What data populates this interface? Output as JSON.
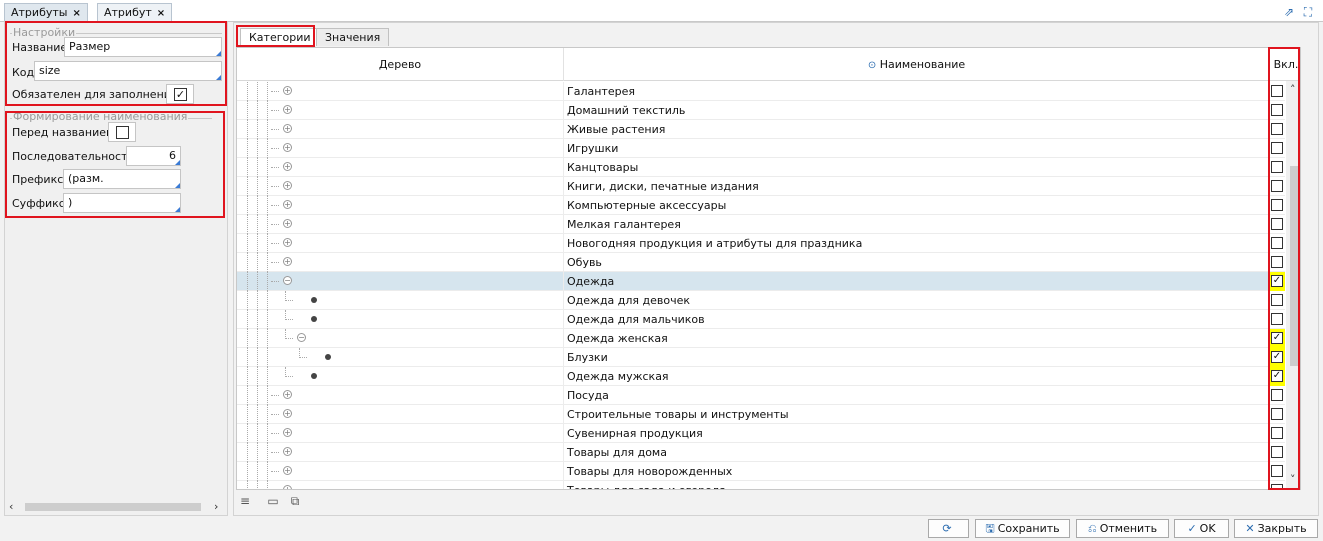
{
  "tabs": [
    {
      "label": "Атрибуты",
      "close": "×"
    },
    {
      "label": "Атрибут",
      "close": "×"
    }
  ],
  "settings": {
    "group_title": "Настройки",
    "name_label": "Название",
    "name_value": "Размер",
    "code_label": "Код",
    "code_value": "size",
    "required_label": "Обязателен для заполнения",
    "required_checked": true
  },
  "naming": {
    "group_title": "Формирование наименования",
    "before_label": "Перед названием",
    "before_checked": false,
    "sequence_label": "Последовательность",
    "sequence_value": "6",
    "prefix_label": "Префикс",
    "prefix_value": "(разм.",
    "suffix_label": "Суффикс",
    "suffix_value": ")"
  },
  "subtabs": [
    "Категории",
    "Значения"
  ],
  "grid": {
    "col_tree": "Дерево",
    "col_name": "Наименование",
    "col_enabled": "Вкл.",
    "rows": [
      {
        "name": "Галантерея",
        "level": 0,
        "kind": "plus",
        "checked": false
      },
      {
        "name": "Домашний текстиль",
        "level": 0,
        "kind": "plus",
        "checked": false
      },
      {
        "name": "Живые растения",
        "level": 0,
        "kind": "plus",
        "checked": false
      },
      {
        "name": "Игрушки",
        "level": 0,
        "kind": "plus",
        "checked": false
      },
      {
        "name": "Канцтовары",
        "level": 0,
        "kind": "plus",
        "checked": false
      },
      {
        "name": "Книги, диски, печатные издания",
        "level": 0,
        "kind": "plus",
        "checked": false
      },
      {
        "name": "Компьютерные аксессуары",
        "level": 0,
        "kind": "plus",
        "checked": false
      },
      {
        "name": "Мелкая галантерея",
        "level": 0,
        "kind": "plus",
        "checked": false
      },
      {
        "name": "Новогодняя продукция и атрибуты для праздника",
        "level": 0,
        "kind": "plus",
        "checked": false
      },
      {
        "name": "Обувь",
        "level": 0,
        "kind": "plus",
        "checked": false
      },
      {
        "name": "Одежда",
        "level": 0,
        "kind": "minus",
        "checked": true,
        "selected": true
      },
      {
        "name": "Одежда для девочек",
        "level": 1,
        "kind": "dot",
        "checked": false
      },
      {
        "name": "Одежда для мальчиков",
        "level": 1,
        "kind": "dot",
        "checked": false
      },
      {
        "name": "Одежда женская",
        "level": 1,
        "kind": "minus",
        "checked": true
      },
      {
        "name": "Блузки",
        "level": 2,
        "kind": "dot",
        "checked": true
      },
      {
        "name": "Одежда мужская",
        "level": 1,
        "kind": "dot",
        "checked": true
      },
      {
        "name": "Посуда",
        "level": 0,
        "kind": "plus",
        "checked": false
      },
      {
        "name": "Строительные товары и инструменты",
        "level": 0,
        "kind": "plus",
        "checked": false
      },
      {
        "name": "Сувенирная продукция",
        "level": 0,
        "kind": "plus",
        "checked": false
      },
      {
        "name": "Товары для дома",
        "level": 0,
        "kind": "plus",
        "checked": false
      },
      {
        "name": "Товары для новорожденных",
        "level": 0,
        "kind": "plus",
        "checked": false
      },
      {
        "name": "Товары для сада и огорода",
        "level": 0,
        "kind": "plus",
        "checked": false
      }
    ]
  },
  "buttons": {
    "refresh": "",
    "save": "Сохранить",
    "cancel": "Отменить",
    "ok": "OK",
    "close": "Закрыть"
  },
  "colors": {
    "highlight": "#ffff00",
    "annotation": "#e0141e",
    "selected_row": "#d6e5ee",
    "accent": "#2b6cb0"
  }
}
